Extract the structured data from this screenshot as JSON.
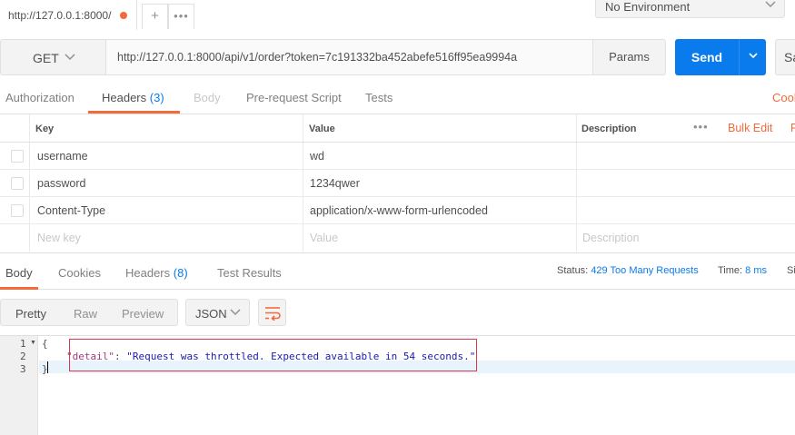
{
  "tabs": {
    "current": {
      "label": "http://127.0.0.1:8000/",
      "unsaved": true
    },
    "add_label": "+",
    "more_label": "•••"
  },
  "environment": {
    "selected": "No Environment"
  },
  "request": {
    "method": "GET",
    "url": "http://127.0.0.1:8000/api/v1/order?token=7c191332ba452abefe516ff95ea9994a",
    "params_label": "Params",
    "send_label": "Send",
    "save_label": "Sa"
  },
  "request_tabs": [
    {
      "label": "Authorization",
      "state": "normal"
    },
    {
      "label": "Headers",
      "count": "(3)",
      "state": "active"
    },
    {
      "label": "Body",
      "state": "disabled"
    },
    {
      "label": "Pre-request Script",
      "state": "normal"
    },
    {
      "label": "Tests",
      "state": "normal"
    }
  ],
  "cookies_label": "Cook",
  "headers_table": {
    "columns": [
      "Key",
      "Value",
      "Description"
    ],
    "more_label": "•••",
    "bulk_edit_label": "Bulk Edit",
    "presets_label": "P",
    "rows": [
      {
        "key": "username",
        "value": "wd",
        "description": ""
      },
      {
        "key": "password",
        "value": "1234qwer",
        "description": ""
      },
      {
        "key": "Content-Type",
        "value": "application/x-www-form-urlencoded",
        "description": ""
      }
    ],
    "new_row": {
      "key": "New key",
      "value": "Value",
      "description": "Description"
    }
  },
  "response_tabs": [
    {
      "label": "Body",
      "state": "active"
    },
    {
      "label": "Cookies",
      "state": "normal"
    },
    {
      "label": "Headers",
      "count": "(8)",
      "state": "normal"
    },
    {
      "label": "Test Results",
      "state": "normal"
    }
  ],
  "response_status": {
    "status_label": "Status:",
    "status_value": "429 Too Many Requests",
    "time_label": "Time:",
    "time_value": "8 ms",
    "size_label": "Si"
  },
  "format": {
    "modes": [
      "Pretty",
      "Raw",
      "Preview"
    ],
    "active_mode": "Pretty",
    "language": "JSON"
  },
  "response_body": {
    "line_numbers": [
      "1",
      "2",
      "3"
    ],
    "open_brace": "{",
    "key": "\"detail\"",
    "separator": ": ",
    "value": "\"Request was throttled. Expected available in 54 seconds.\"",
    "close_brace": "}"
  },
  "colors": {
    "accent": "#f26b3a",
    "primary": "#097bed",
    "json_key": "#a0397b",
    "json_string": "#1d1ba8",
    "annotation_box": "#d93a4a"
  }
}
